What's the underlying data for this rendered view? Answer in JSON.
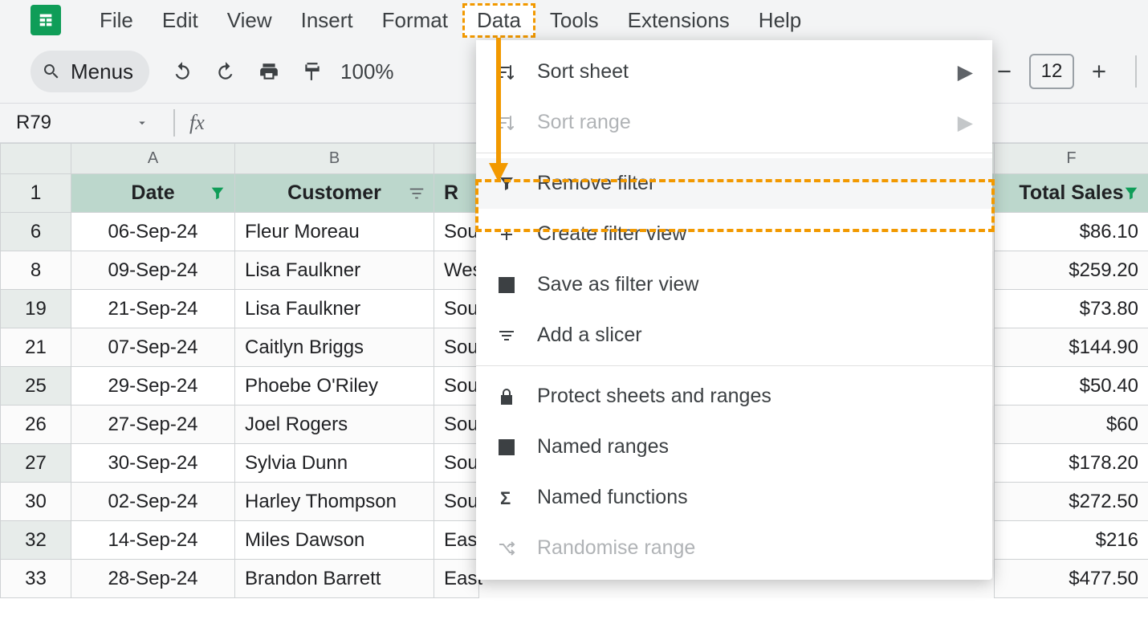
{
  "menubar": [
    "File",
    "Edit",
    "View",
    "Insert",
    "Format",
    "Data",
    "Tools",
    "Extensions",
    "Help"
  ],
  "menubar_active_index": 5,
  "toolbar": {
    "search_label": "Menus",
    "zoom": "100%",
    "font_size": "12"
  },
  "namebox": "R79",
  "columns": [
    {
      "letter": "A",
      "label": "Date",
      "filter_style": "funnel"
    },
    {
      "letter": "B",
      "label": "Customer",
      "filter_style": "lines"
    },
    {
      "letter": "",
      "label": "R",
      "filter_style": ""
    },
    {
      "letter": "F",
      "label": "Total Sales",
      "filter_style": "funnel"
    }
  ],
  "row_header_first": "1",
  "rows": [
    {
      "n": "6",
      "date": "06-Sep-24",
      "customer": "Fleur Moreau",
      "region": "Sou",
      "total": "$86.10"
    },
    {
      "n": "8",
      "date": "09-Sep-24",
      "customer": "Lisa Faulkner",
      "region": "Wes",
      "total": "$259.20"
    },
    {
      "n": "19",
      "date": "21-Sep-24",
      "customer": "Lisa Faulkner",
      "region": "Sou",
      "total": "$73.80"
    },
    {
      "n": "21",
      "date": "07-Sep-24",
      "customer": "Caitlyn Briggs",
      "region": "Sou",
      "total": "$144.90"
    },
    {
      "n": "25",
      "date": "29-Sep-24",
      "customer": "Phoebe O'Riley",
      "region": "Sou",
      "total": "$50.40"
    },
    {
      "n": "26",
      "date": "27-Sep-24",
      "customer": "Joel Rogers",
      "region": "Sou",
      "total": "$60"
    },
    {
      "n": "27",
      "date": "30-Sep-24",
      "customer": "Sylvia Dunn",
      "region": "Sou",
      "total": "$178.20"
    },
    {
      "n": "30",
      "date": "02-Sep-24",
      "customer": "Harley Thompson",
      "region": "Sou",
      "total": "$272.50"
    },
    {
      "n": "32",
      "date": "14-Sep-24",
      "customer": "Miles Dawson",
      "region": "East",
      "total": "$216"
    },
    {
      "n": "33",
      "date": "28-Sep-24",
      "customer": "Brandon Barrett",
      "region": "East",
      "total": "$477.50"
    }
  ],
  "dropdown": {
    "groups": [
      [
        {
          "label": "Sort sheet",
          "icon": "sort",
          "submenu": true,
          "disabled": false
        },
        {
          "label": "Sort range",
          "icon": "sort",
          "submenu": true,
          "disabled": true
        }
      ],
      [
        {
          "label": "Remove filter",
          "icon": "funnel",
          "highlight": true
        },
        {
          "label": "Create filter view",
          "icon": "plus"
        },
        {
          "label": "Save as filter view",
          "icon": "grid"
        },
        {
          "label": "Add a slicer",
          "icon": "slicer"
        }
      ],
      [
        {
          "label": "Protect sheets and ranges",
          "icon": "lock"
        },
        {
          "label": "Named ranges",
          "icon": "namedrange"
        },
        {
          "label": "Named functions",
          "icon": "sigma"
        },
        {
          "label": "Randomise range",
          "icon": "shuffle",
          "disabled": true
        }
      ]
    ]
  }
}
